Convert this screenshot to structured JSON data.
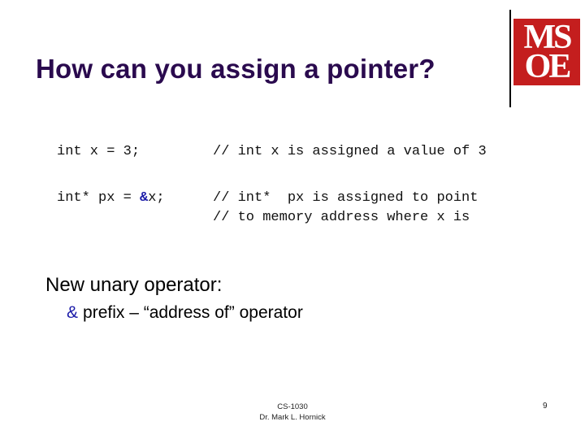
{
  "slide": {
    "title": "How can you assign a pointer?",
    "logo": {
      "line1": "MS",
      "line2": "OE",
      "color": "#c41e1e"
    },
    "code": [
      {
        "statement": "int x = 3;",
        "comment": "// int x is assigned a value of 3"
      },
      {
        "statement_prefix": "int* px = ",
        "statement_op": "&",
        "statement_suffix": "x;",
        "comment": "// int*  px is assigned to point"
      },
      {
        "comment": "// to memory address where x is"
      }
    ],
    "body": {
      "heading": "New unary operator:",
      "bullet_symbol": "&",
      "bullet_text": "prefix – “address of” operator"
    },
    "footer": {
      "course": "CS-1030",
      "author": "Dr. Mark L. Hornick",
      "page": "9"
    }
  }
}
